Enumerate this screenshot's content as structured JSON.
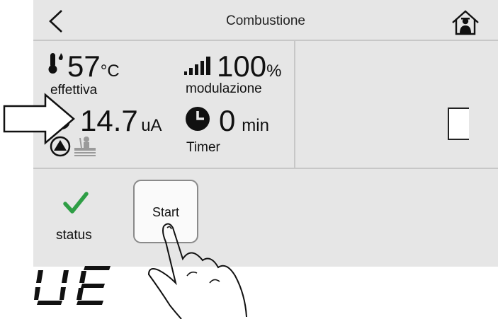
{
  "header": {
    "title": "Combustione",
    "back_icon": "chevron-left-icon",
    "home_icon": "house-person-icon"
  },
  "stats": {
    "temperature": {
      "value": "57",
      "unit": "°C",
      "label": "effettiva",
      "icon": "thermometer-icon"
    },
    "modulation": {
      "value": "100",
      "unit": "%",
      "label": "modulazione",
      "icon": "signal-bars-icon"
    },
    "flame_current": {
      "value": "14.7",
      "unit": "uA",
      "icon": "flame-icon"
    },
    "timer": {
      "value": "0",
      "unit": "min",
      "label": "Timer",
      "icon": "clock-icon"
    }
  },
  "status": {
    "label": "status",
    "icon": "checkmark-icon",
    "color": "#2e9e45"
  },
  "start_button": {
    "label": "Start"
  },
  "display": {
    "text": "UE"
  },
  "overlay": {
    "arrow_icon": "pointer-arrow-icon",
    "hand_icon": "hand-tap-icon"
  }
}
